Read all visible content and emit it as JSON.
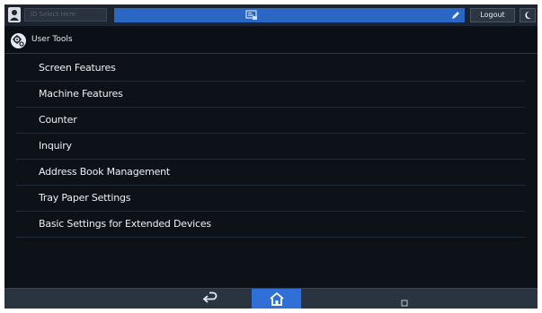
{
  "topbar": {
    "login_placeholder": "ID Select Here",
    "logout_label": "Logout",
    "icons": {
      "user": "user-icon",
      "job_status": "job-status-icon",
      "edit": "pen-icon",
      "energy_saver": "moon-icon"
    }
  },
  "titlebar": {
    "title": "User Tools",
    "icon": "gear-icon"
  },
  "menu": {
    "items": [
      {
        "label": "Screen Features"
      },
      {
        "label": "Machine Features"
      },
      {
        "label": "Counter"
      },
      {
        "label": "Inquiry"
      },
      {
        "label": "Address Book Management"
      },
      {
        "label": "Tray Paper Settings"
      },
      {
        "label": "Basic Settings for Extended Devices"
      }
    ]
  },
  "bottombar": {
    "icons": {
      "back": "back-arrow-icon",
      "home": "home-icon",
      "recent": "square-icon"
    }
  },
  "colors": {
    "background": "#0d1219",
    "status_bar_blue": "#2a66c4",
    "home_button_blue": "#2f6fd6",
    "text": "#eef1f4"
  }
}
